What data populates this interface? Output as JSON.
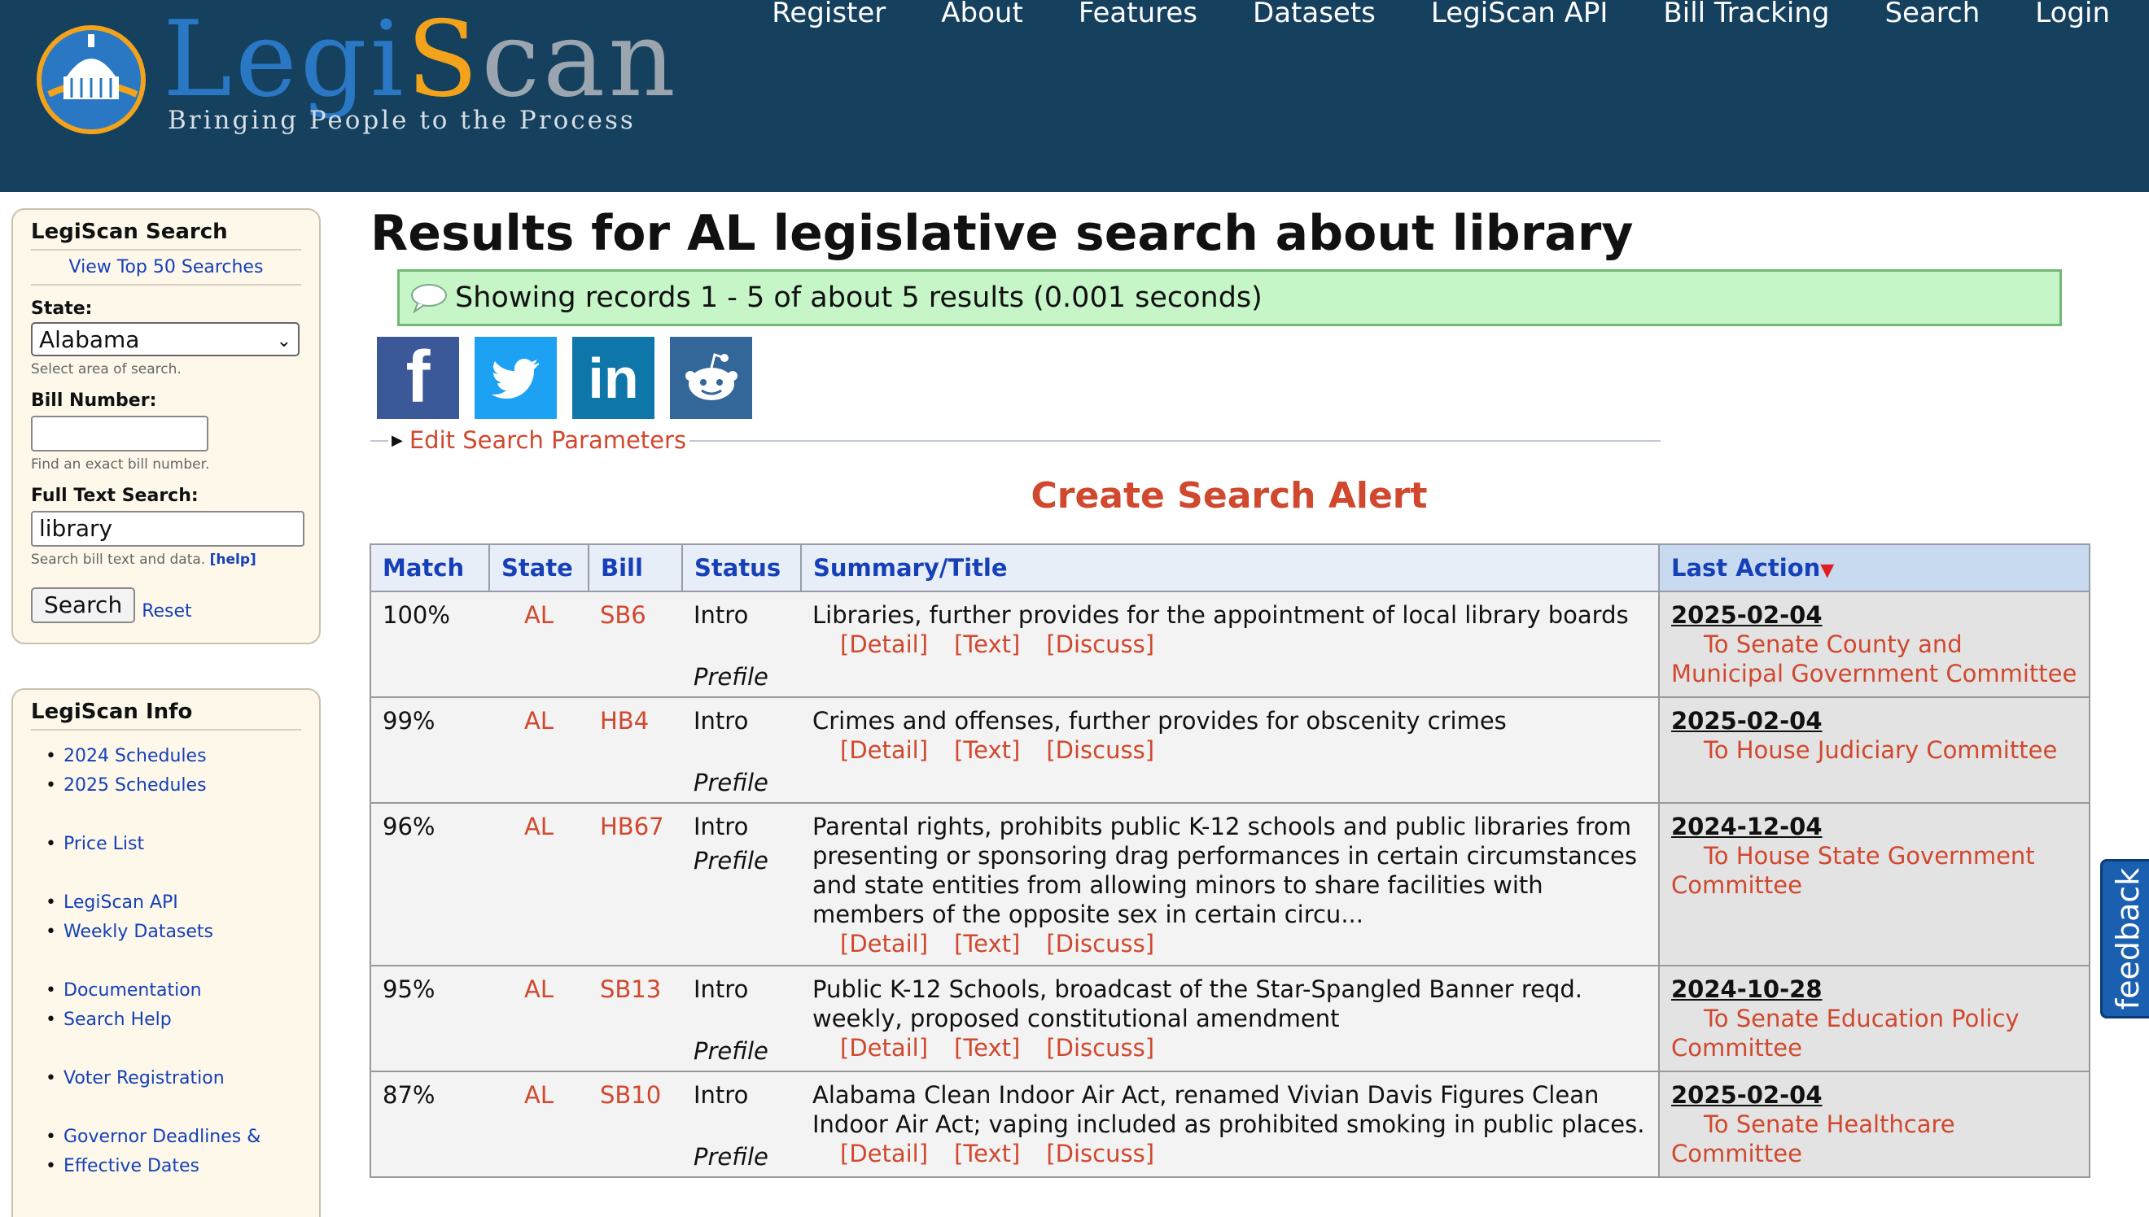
{
  "header": {
    "logo_word_1": "Legi",
    "logo_word_2": "S",
    "logo_word_3": "can",
    "logo_tagline": "Bringing People to the Process",
    "nav": [
      "Register",
      "About",
      "Features",
      "Datasets",
      "LegiScan API",
      "Bill Tracking",
      "Search",
      "Login"
    ]
  },
  "sidebar_search": {
    "title": "LegiScan Search",
    "top_searches_link": "View Top 50 Searches",
    "state_label": "State:",
    "state_value": "Alabama",
    "state_help": "Select area of search.",
    "bill_label": "Bill Number:",
    "bill_value": "",
    "bill_help": "Find an exact bill number.",
    "fulltext_label": "Full Text Search:",
    "fulltext_value": "library",
    "fulltext_help": "Search bill text and data.",
    "help_link": "[help]",
    "search_button": "Search",
    "reset_link": "Reset"
  },
  "sidebar_info": {
    "title": "LegiScan Info",
    "links": [
      "2024 Schedules",
      "2025 Schedules",
      "Price List",
      "LegiScan API",
      "Weekly Datasets",
      "Documentation",
      "Search Help",
      "Voter Registration",
      "Governor Deadlines &",
      "Effective Dates"
    ]
  },
  "main": {
    "title": "Results for AL legislative search about library",
    "status": "Showing records 1 - 5 of about 5 results (0.001 seconds)",
    "social": {
      "facebook": "f",
      "linkedin": "in"
    },
    "edit_params": "Edit Search Parameters",
    "create_alert": "Create Search Alert"
  },
  "table": {
    "headers": [
      "Match",
      "State",
      "Bill",
      "Status",
      "Summary/Title",
      "Last Action"
    ],
    "link_labels": [
      "[Detail]",
      "[Text]",
      "[Discuss]"
    ],
    "rows": [
      {
        "match": "100%",
        "state": "AL",
        "bill": "SB6",
        "status": "Intro",
        "substatus": "Prefile",
        "summary": "Libraries, further provides for the appointment of local library boards",
        "date": "2025-02-04",
        "action": "To Senate County and Municipal Government Committee"
      },
      {
        "match": "99%",
        "state": "AL",
        "bill": "HB4",
        "status": "Intro",
        "substatus": "Prefile",
        "summary": "Crimes and offenses, further provides for obscenity crimes",
        "date": "2025-02-04",
        "action": "To House Judiciary Committee"
      },
      {
        "match": "96%",
        "state": "AL",
        "bill": "HB67",
        "status": "Intro",
        "substatus": "Prefile",
        "summary": "Parental rights, prohibits public K-12 schools and public libraries from presenting or sponsoring drag performances in certain circumstances and state entities from allowing minors to share facilities with members of the opposite sex in certain circu...",
        "date": "2024-12-04",
        "action": "To House State Government Committee"
      },
      {
        "match": "95%",
        "state": "AL",
        "bill": "SB13",
        "status": "Intro",
        "substatus": "Prefile",
        "summary": "Public K-12 Schools, broadcast of the Star-Spangled Banner reqd. weekly, proposed constitutional amendment",
        "date": "2024-10-28",
        "action": "To Senate Education Policy Committee"
      },
      {
        "match": "87%",
        "state": "AL",
        "bill": "SB10",
        "status": "Intro",
        "substatus": "Prefile",
        "summary": "Alabama Clean Indoor Air Act, renamed Vivian Davis Figures Clean Indoor Air Act; vaping included as prohibited smoking in public places.",
        "date": "2025-02-04",
        "action": "To Senate Healthcare Committee"
      }
    ]
  },
  "feedback": "feedback",
  "colors": {
    "header_bg": "#15405e",
    "accent_red": "#d0482e",
    "link_blue": "#1540b8",
    "status_green": "#c6f5c8"
  }
}
